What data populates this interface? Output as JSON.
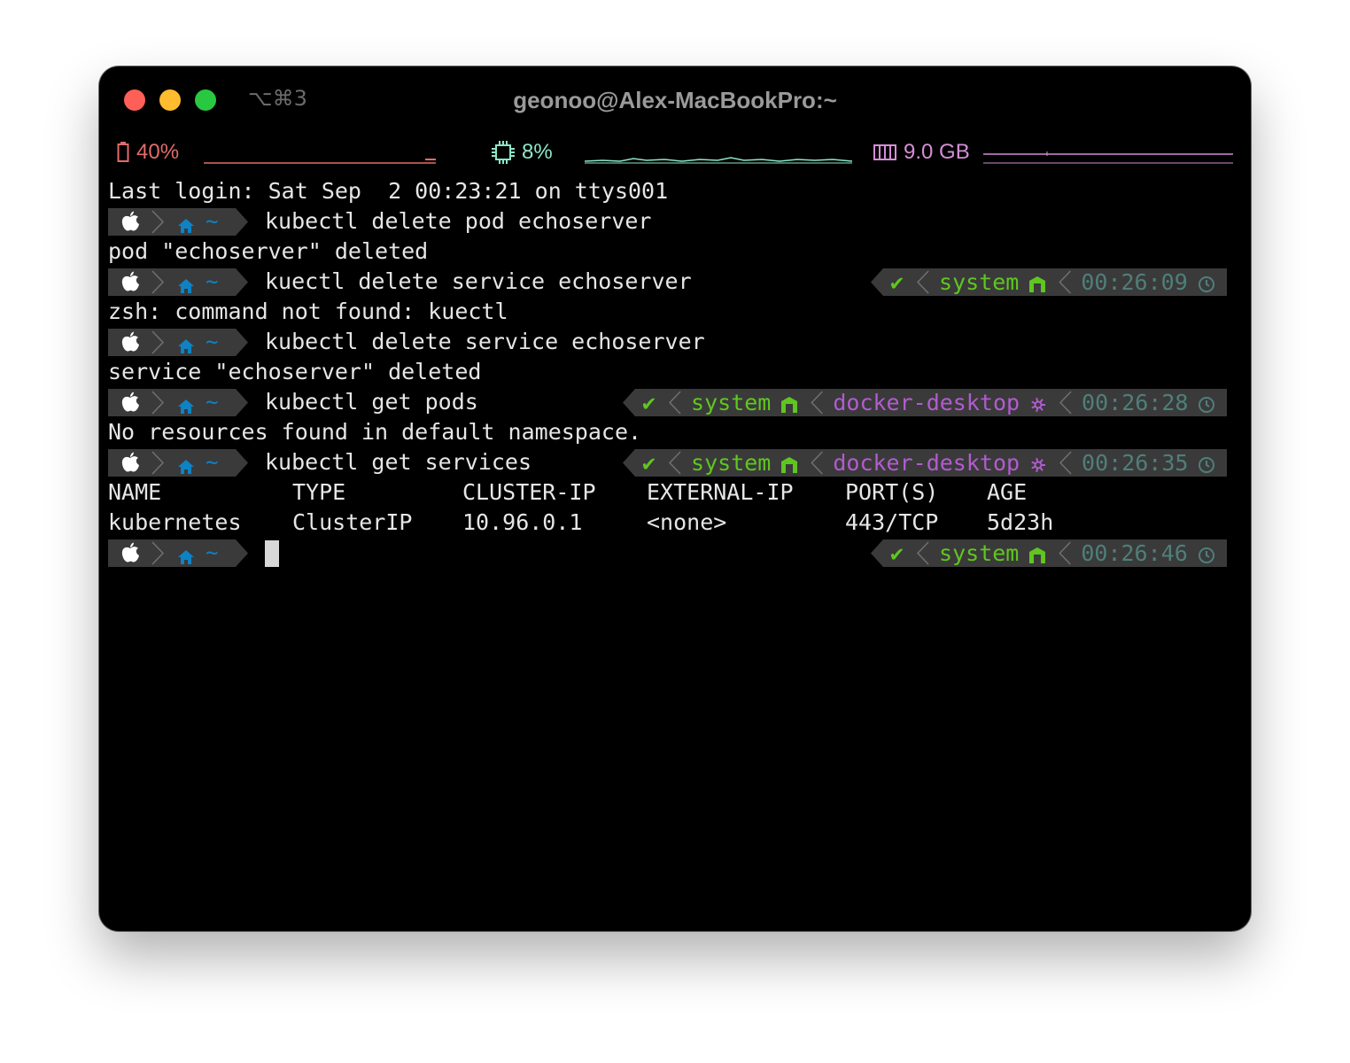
{
  "window": {
    "title": "geonoo@Alex-MacBookPro:~",
    "tab_shortcut": "⌥⌘3"
  },
  "status_bar": {
    "battery": "40%",
    "cpu": "8%",
    "memory": "9.0 GB"
  },
  "colors": {
    "battery": "#e26b6b",
    "cpu": "#8de6c8",
    "memory": "#d58ed6",
    "prompt_segment": "#3a3a3a",
    "prompt_icon": "#0f82c4",
    "ok_green": "#5fc620",
    "k8s_purple": "#b25bd0",
    "time": "#4f7f7a"
  },
  "prompt": {
    "apple_icon": "",
    "home_icon": "🏠",
    "dir": "~",
    "check": "✔",
    "node_icon": "⬢",
    "k8s_icon": "⎈",
    "clock_icon": "◷"
  },
  "terminal": {
    "last_login": "Last login: Sat Sep  2 00:23:21 on ttys001",
    "lines": [
      {
        "cmd": "kubectl delete pod echoserver"
      },
      {
        "out": "pod \"echoserver\" deleted"
      },
      {
        "cmd": "kuectl delete service echoserver",
        "status": "system",
        "time": "00:26:09"
      },
      {
        "out": "zsh: command not found: kuectl"
      },
      {
        "cmd": "kubectl delete service echoserver"
      },
      {
        "out": "service \"echoserver\" deleted"
      },
      {
        "cmd": "kubectl get pods",
        "status": "system",
        "context": "docker-desktop",
        "time": "00:26:28"
      },
      {
        "out": "No resources found in default namespace."
      },
      {
        "cmd": "kubectl get services",
        "status": "system",
        "context": "docker-desktop",
        "time": "00:26:35"
      },
      {
        "table_headers": [
          "NAME",
          "TYPE",
          "CLUSTER-IP",
          "EXTERNAL-IP",
          "PORT(S)",
          "AGE"
        ]
      },
      {
        "table_row": [
          "kubernetes",
          "ClusterIP",
          "10.96.0.1",
          "<none>",
          "443/TCP",
          "5d23h"
        ]
      },
      {
        "cmd": "",
        "status": "system",
        "time": "00:26:46"
      }
    ]
  }
}
